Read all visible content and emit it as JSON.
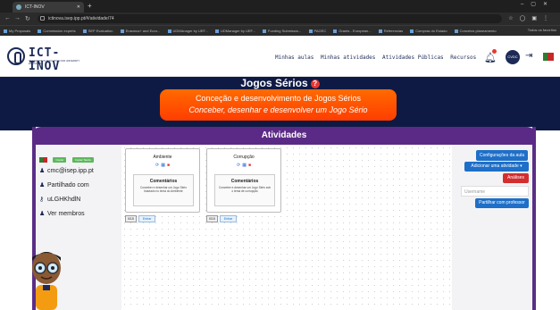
{
  "browser": {
    "tab_title": "ICT-INOV",
    "url": "ictinova.isep.ipp.pt/#/atividade/74",
    "bookmarks": [
      "My Proposals",
      "Commission experts",
      "SEP Evaluation",
      "Erasmus+ and Euro...",
      "UDMAnager by UEF...",
      "UDManager by UEF...",
      "Funding Submissio...",
      "PAGEC",
      "Grants - European...",
      "Referencias",
      "Compras do Estado",
      "Concelos planeamento"
    ],
    "bookmarks_right": "Todos os favoritos"
  },
  "header": {
    "logo_name": "ICT-INOV",
    "logo_tagline": "INNOVATION IN EDUCATION FOR UNIVERSITY EDUCATORS",
    "nav": [
      "Minhas aulas",
      "Minhas atividades",
      "Atividades Públicas",
      "Recursos"
    ],
    "avatar_initials": "CVDC"
  },
  "hero": {
    "title": "Jogos Sérios",
    "help_glyph": "?",
    "subtitle": "Conceção e desenvolvimento de Jogos Sérios",
    "tagline": "Conceber, desenhar e desenvolver um Jogo Sério"
  },
  "activities": {
    "heading": "Atividades"
  },
  "left_panel": {
    "buttons": [
      "Copiar",
      "Copiar Tarefa"
    ],
    "email": "cmc@isep.ipp.pt",
    "shared": "Partilhado com",
    "code": "uLGHKhdlN",
    "members": "Ver membros"
  },
  "cards": [
    {
      "title": "Ambiente",
      "comments_heading": "Comentários",
      "comments_text": "Conceber e desenhar um Jogo Sério baseado no tema do Ambiente",
      "foot_count": "0/15",
      "foot_action": "Entrar"
    },
    {
      "title": "Corrupção",
      "comments_heading": "Comentários",
      "comments_text": "Conceber e desenhar um Jogo Sério sob o tema de corrupção",
      "foot_count": "0/15",
      "foot_action": "Entrar"
    }
  ],
  "right_panel": {
    "config": "Configurações da aula",
    "add_activity": "Adicionar uma atividade",
    "analysis": "Análises",
    "username_placeholder": "Username",
    "share_teacher": "Partilhar com professor"
  },
  "colors": {
    "navy": "#0e1a44",
    "purple": "#5b2a86",
    "orange": "#ff5a00",
    "blue_button": "#1e6fc8",
    "red_button": "#d32f2f"
  }
}
